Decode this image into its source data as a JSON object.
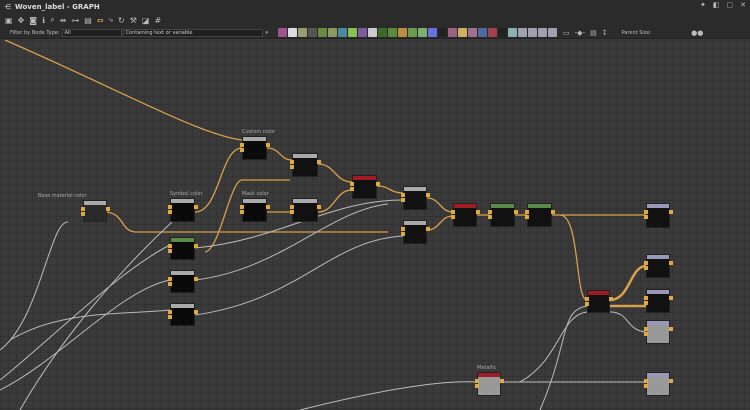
{
  "window": {
    "title": "Woven_label - GRAPH"
  },
  "filter": {
    "label": "Filter by Node Type:",
    "node_type": "All",
    "search_placeholder": "Containing text or variable",
    "parent_size_label": "Parent Size:"
  },
  "palette": [
    "#a0528e",
    "#ddd",
    "#9a9a70",
    "#555",
    "#6a8a40",
    "#8a9a60",
    "#4a8aa0",
    "#8ac050",
    "#7a5aa0",
    "#ccc",
    "#3a6a2a",
    "#5a8a3a",
    "#c08a40",
    "#6a9a50",
    "#7ab070",
    "#6a70e0",
    "#222",
    "#a06080",
    "#d0b060",
    "#a07090",
    "#4a6aa0",
    "#a04050",
    "#222",
    "#8ab0b0",
    "#a0a0b0",
    "#a0a0b0",
    "#a0a0b0",
    "#a0a0b0"
  ],
  "nodes": {
    "custom_color": "Custom color",
    "base_material_color": "Base material color",
    "symbol_color": "Symbol color",
    "mask_color": "Mask color",
    "metallic": "Metallic"
  },
  "colors": {
    "link_orange": "#d7a04a",
    "link_gray": "#bbbbbb",
    "accent_red": "#a01c24",
    "accent_green": "#5a8a4a",
    "output_header": "#9a98b8"
  }
}
